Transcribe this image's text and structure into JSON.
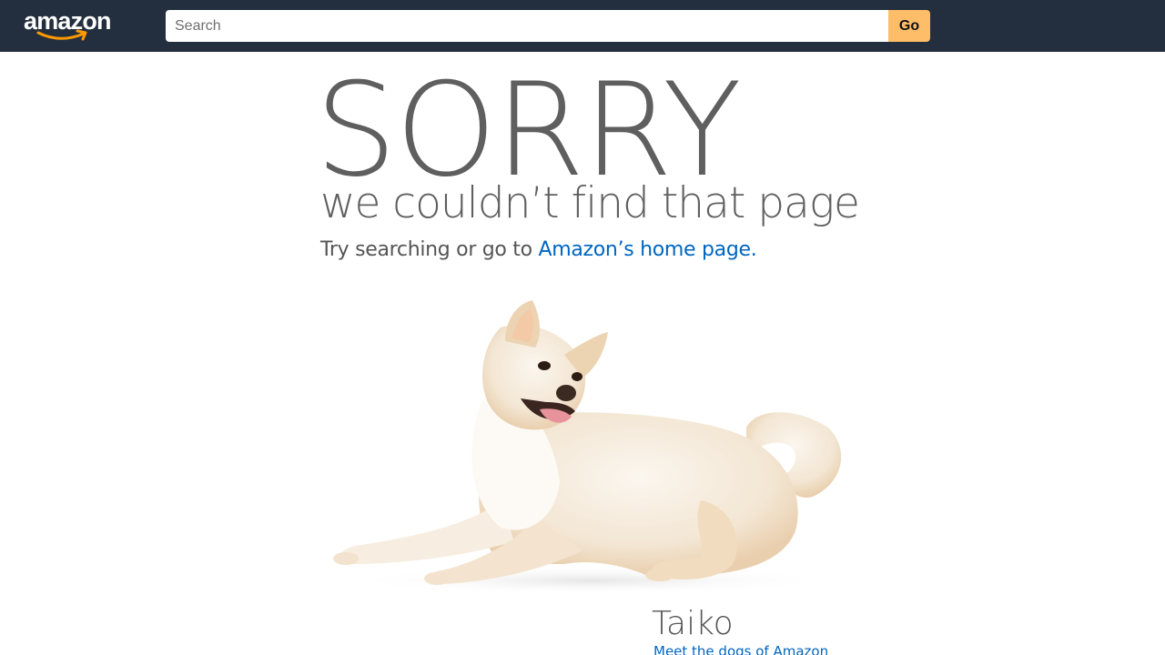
{
  "header": {
    "logo_text": "amazon",
    "search": {
      "placeholder": "Search",
      "value": ""
    },
    "go_label": "Go"
  },
  "main": {
    "headline": "SORRY",
    "subheadline": "we couldn’t find that page",
    "try_prefix": "Try searching or go to ",
    "home_link_label": "Amazon’s home page",
    "try_suffix": ".",
    "dog_name": "Taiko",
    "dogs_link_label": "Meet the dogs of Amazon"
  },
  "colors": {
    "header_bg": "#232f3e",
    "go_button": "#febd69",
    "link": "#0066c0",
    "headline": "#5f5f5f"
  }
}
